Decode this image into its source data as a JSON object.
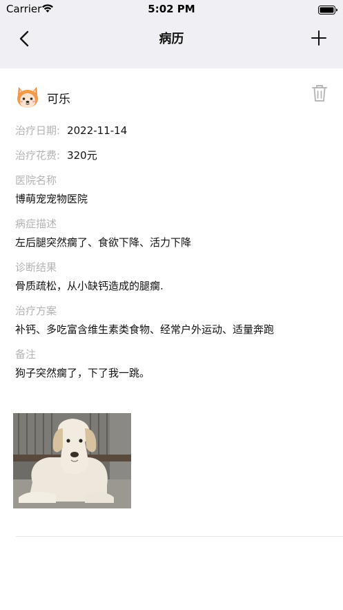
{
  "status_bar": {
    "carrier": "Carrier",
    "time": "5:02 PM"
  },
  "nav": {
    "title": "病历",
    "back_icon": "chevron-left-icon",
    "add_icon": "plus-icon"
  },
  "pet": {
    "name": "可乐",
    "avatar_icon": "shiba-dog-avatar-icon",
    "delete_icon": "trash-icon"
  },
  "record": {
    "treatment_date_label": "治疗日期:",
    "treatment_date": "2022-11-14",
    "cost_label": "治疗花费:",
    "cost": "320元",
    "hospital_label": "医院名称",
    "hospital": "博萌宠宠物医院",
    "symptom_label": "病症描述",
    "symptom": "左后腿突然瘸了、食欲下降、活力下降",
    "diagnosis_label": "诊断结果",
    "diagnosis": "骨质疏松，从小缺钙造成的腿瘸.",
    "treatment_label": "治疗方案",
    "treatment": "补钙、多吃富含维生素类食物、经常户外运动、适量奔跑",
    "notes_label": "备注",
    "notes": "狗子突然瘸了，下了我一跳。"
  },
  "colors": {
    "bar_background": "#efeff4",
    "label_gray": "#b3b3b3",
    "text": "#111111"
  }
}
